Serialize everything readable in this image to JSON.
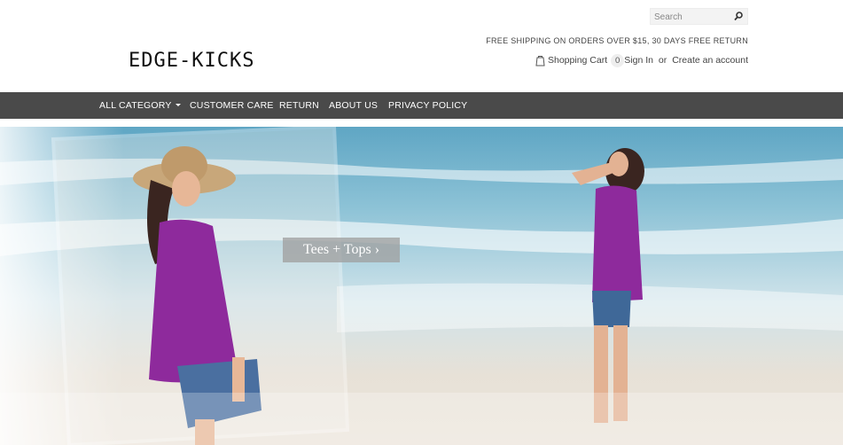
{
  "brand": {
    "logo_text": "EDGE-KICKS"
  },
  "search": {
    "placeholder": "Search",
    "icon": "search-icon"
  },
  "promo": {
    "shipping_text": "FREE SHIPPING ON ORDERS OVER $15, 30 DAYS FREE RETURN"
  },
  "cart": {
    "label": "Shopping Cart",
    "count": "0",
    "icon": "shopping-bag-icon"
  },
  "account": {
    "sign_in": "Sign In",
    "separator": "or",
    "create": "Create an account"
  },
  "nav": {
    "items": [
      {
        "label": "ALL CATEGORY",
        "has_dropdown": true
      },
      {
        "label": "CUSTOMER CARE"
      },
      {
        "label": "RETURN"
      },
      {
        "label": "ABOUT US"
      },
      {
        "label": "PRIVACY POLICY"
      }
    ]
  },
  "hero": {
    "cta_label": "Tees + Tops ›"
  },
  "colors": {
    "nav_bg": "#4a4a4a",
    "accent_purple": "#8e2a9c",
    "sea": "#7fb8cf",
    "sand": "#e8ddd0"
  }
}
